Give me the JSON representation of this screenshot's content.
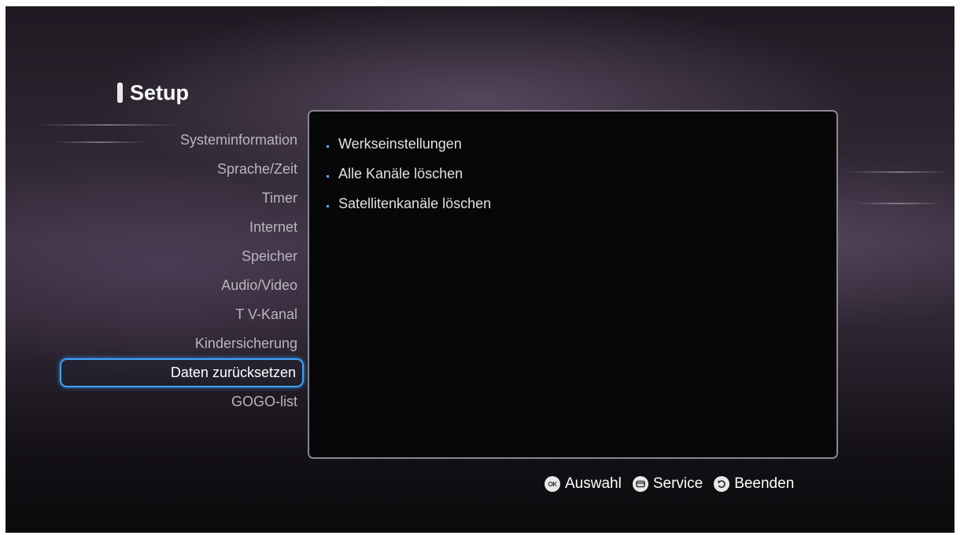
{
  "title": "Setup",
  "menu": [
    {
      "label": "Systeminformation"
    },
    {
      "label": "Sprache/Zeit"
    },
    {
      "label": "Timer"
    },
    {
      "label": "Internet"
    },
    {
      "label": "Speicher"
    },
    {
      "label": "Audio/Video"
    },
    {
      "label": "T V-Kanal"
    },
    {
      "label": "Kindersicherung"
    },
    {
      "label": "Daten zurücksetzen",
      "selected": true
    },
    {
      "label": "GOGO-list"
    }
  ],
  "options": [
    {
      "label": "Werkseinstellungen"
    },
    {
      "label": "Alle Kanäle löschen"
    },
    {
      "label": "Satellitenkanäle löschen"
    }
  ],
  "footer": {
    "ok_icon_text": "OK",
    "select_label": "Auswahl",
    "service_label": "Service",
    "exit_label": "Beenden"
  },
  "colors": {
    "selection_border": "#3aa5ff",
    "bullet": "#5aa9ff",
    "panel_background": "#07070a"
  },
  "icons": {
    "ok": "ok-button-icon",
    "service": "menu-button-icon",
    "exit": "return-button-icon"
  }
}
